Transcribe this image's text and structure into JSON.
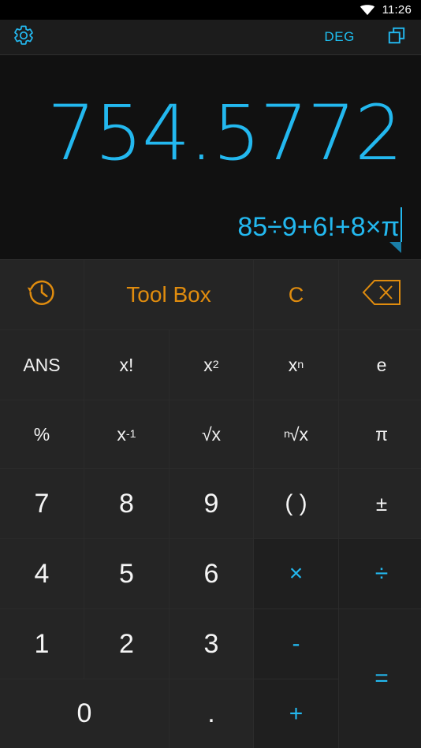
{
  "statusbar": {
    "time": "11:26",
    "wifi_icon": "wifi-icon"
  },
  "toolbar": {
    "settings_icon": "gear-icon",
    "angle_mode": "DEG",
    "window_icon": "multi-window-icon"
  },
  "display": {
    "result": "754.5772",
    "expression": "85÷9+6!+8×π",
    "caret_visible": true
  },
  "colors": {
    "accent_cyan": "#23b8ef",
    "accent_orange": "#e08c0e",
    "key_bg": "#252525",
    "op_key_bg": "#1f1f1f",
    "app_bg": "#111111",
    "toolbar_bg": "#1c1c1c",
    "status_bg": "#000000",
    "text_white": "#f5f5f5"
  },
  "keypad": {
    "rows": [
      {
        "name": "function-row",
        "keys": [
          {
            "name": "history-button",
            "label": "",
            "icon": "history-icon",
            "type": "fn"
          },
          {
            "name": "tool-box-button",
            "label": "Tool Box",
            "icon": "",
            "type": "fn toolbox"
          },
          {
            "name": "clear-button",
            "label": "C",
            "icon": "",
            "type": "fn"
          },
          {
            "name": "backspace-button",
            "label": "",
            "icon": "backspace-icon",
            "type": "fn"
          }
        ]
      },
      {
        "name": "sci-row-1",
        "keys": [
          {
            "name": "ans-button",
            "label": "ANS",
            "type": "sci"
          },
          {
            "name": "factorial-button",
            "label": "x!",
            "type": "sci"
          },
          {
            "name": "square-button",
            "label": "x2",
            "type": "sci"
          },
          {
            "name": "power-button",
            "label": "xn",
            "type": "sci"
          },
          {
            "name": "euler-button",
            "label": "e",
            "type": "sci"
          }
        ]
      },
      {
        "name": "sci-row-2",
        "keys": [
          {
            "name": "percent-button",
            "label": "%",
            "type": "sci"
          },
          {
            "name": "reciprocal-button",
            "label": "x-1",
            "type": "sci"
          },
          {
            "name": "square-root-button",
            "label": "√x",
            "type": "sci"
          },
          {
            "name": "nth-root-button",
            "label": "n√x",
            "type": "sci"
          },
          {
            "name": "pi-button",
            "label": "π",
            "type": "sci"
          }
        ]
      },
      {
        "name": "digit-row-789",
        "keys": [
          {
            "name": "digit-7-button",
            "label": "7",
            "type": "digit"
          },
          {
            "name": "digit-8-button",
            "label": "8",
            "type": "digit"
          },
          {
            "name": "digit-9-button",
            "label": "9",
            "type": "digit"
          },
          {
            "name": "parentheses-button",
            "label": "( )",
            "type": "paren"
          },
          {
            "name": "sign-toggle-button",
            "label": "±",
            "type": "pm"
          }
        ]
      },
      {
        "name": "digit-row-456",
        "keys": [
          {
            "name": "digit-4-button",
            "label": "4",
            "type": "digit"
          },
          {
            "name": "digit-5-button",
            "label": "5",
            "type": "digit"
          },
          {
            "name": "digit-6-button",
            "label": "6",
            "type": "digit"
          },
          {
            "name": "multiply-button",
            "label": "×",
            "type": "op"
          },
          {
            "name": "divide-button",
            "label": "÷",
            "type": "op"
          }
        ]
      },
      {
        "name": "digit-row-123",
        "keys": [
          {
            "name": "digit-1-button",
            "label": "1",
            "type": "digit"
          },
          {
            "name": "digit-2-button",
            "label": "2",
            "type": "digit"
          },
          {
            "name": "digit-3-button",
            "label": "3",
            "type": "digit"
          },
          {
            "name": "subtract-button",
            "label": "-",
            "type": "op"
          },
          {
            "name": "equals-button",
            "label": "=",
            "type": "equals"
          }
        ]
      },
      {
        "name": "digit-row-0",
        "keys": [
          {
            "name": "digit-0-button",
            "label": "0",
            "type": "digit"
          },
          {
            "name": "decimal-button",
            "label": ".",
            "type": "digit"
          },
          {
            "name": "add-button",
            "label": "+",
            "type": "op"
          }
        ]
      }
    ],
    "labels": {
      "history": "history",
      "tool_box": "Tool Box",
      "clear": "C",
      "backspace": "backspace",
      "ans": "ANS",
      "factorial": "x!",
      "square_base": "x",
      "square_exp": "2",
      "power_base": "x",
      "power_exp": "n",
      "euler": "e",
      "percent": "%",
      "reciprocal_base": "x",
      "reciprocal_exp": "-1",
      "sqrt": "√x",
      "nth_root_pre": "n",
      "nth_root": "√x",
      "pi": "π",
      "d7": "7",
      "d8": "8",
      "d9": "9",
      "parentheses": "( )",
      "plus_minus": "±",
      "d4": "4",
      "d5": "5",
      "d6": "6",
      "multiply": "×",
      "divide": "÷",
      "d1": "1",
      "d2": "2",
      "d3": "3",
      "subtract": "-",
      "equals": "=",
      "d0": "0",
      "decimal": ".",
      "add": "+"
    }
  }
}
